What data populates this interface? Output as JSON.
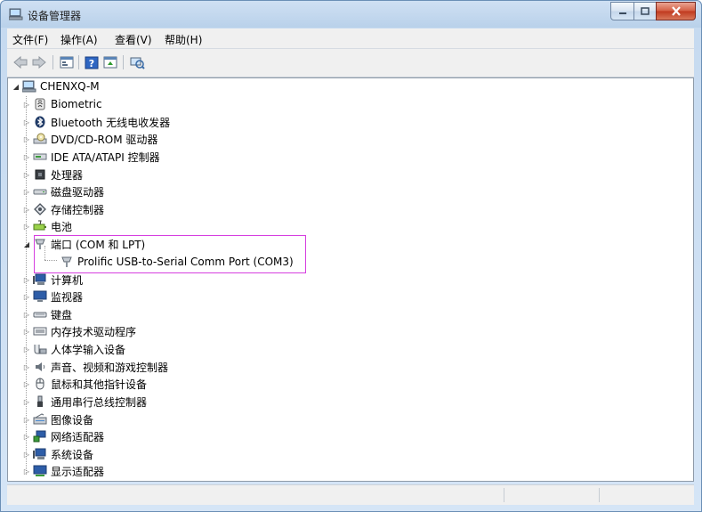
{
  "window": {
    "title": "设备管理器"
  },
  "menu": [
    {
      "label": "文件(F)"
    },
    {
      "label": "操作(A)"
    },
    {
      "label": "查看(V)"
    },
    {
      "label": "帮助(H)"
    }
  ],
  "toolbar": [
    "back-icon",
    "forward-icon",
    "properties-icon",
    "help-icon",
    "update-driver-icon",
    "scan-hardware-icon"
  ],
  "tree": {
    "root": "CHENXQ-M",
    "categories": [
      {
        "label": "Biometric"
      },
      {
        "label": "Bluetooth 无线电收发器"
      },
      {
        "label": "DVD/CD-ROM 驱动器"
      },
      {
        "label": "IDE ATA/ATAPI 控制器"
      },
      {
        "label": "处理器"
      },
      {
        "label": "磁盘驱动器"
      },
      {
        "label": "存储控制器"
      },
      {
        "label": "电池"
      },
      {
        "label": "端口 (COM 和 LPT)",
        "expanded": true,
        "children": [
          "Prolific USB-to-Serial Comm Port (COM3)"
        ]
      },
      {
        "label": "计算机"
      },
      {
        "label": "监视器"
      },
      {
        "label": "键盘"
      },
      {
        "label": "内存技术驱动程序"
      },
      {
        "label": "人体学输入设备"
      },
      {
        "label": "声音、视频和游戏控制器"
      },
      {
        "label": "鼠标和其他指针设备"
      },
      {
        "label": "通用串行总线控制器"
      },
      {
        "label": "图像设备"
      },
      {
        "label": "网络适配器"
      },
      {
        "label": "系统设备"
      },
      {
        "label": "显示适配器"
      }
    ]
  },
  "colors": {
    "highlight_border": "#d63fe0",
    "title_bar": "#c6daf0",
    "close_button": "#c0391e"
  }
}
